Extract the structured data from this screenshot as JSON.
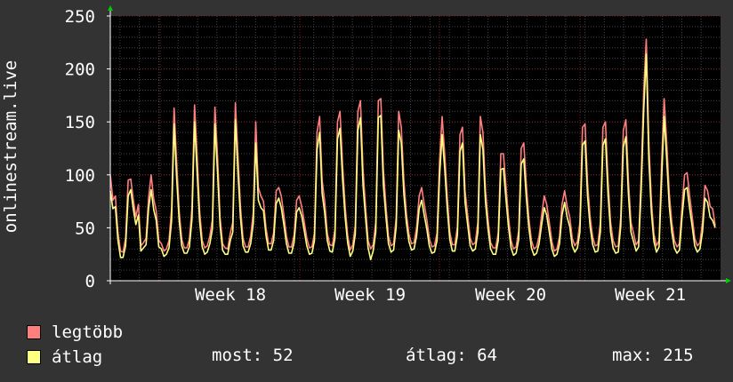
{
  "chart_data": {
    "type": "line",
    "ylabel": "onlinestream.live",
    "ylim": [
      0,
      250
    ],
    "yticks": [
      0,
      50,
      100,
      150,
      200,
      250
    ],
    "xticks": [
      "Week 18",
      "Week 19",
      "Week 20",
      "Week 21"
    ],
    "grid": true,
    "legend_position": "bottom-left",
    "series": [
      {
        "name": "legtöbb",
        "color": "#ff7f7f",
        "values": [
          100,
          76,
          80,
          45,
          28,
          27,
          40,
          95,
          96,
          77,
          60,
          72,
          33,
          36,
          40,
          78,
          100,
          77,
          66,
          38,
          35,
          28,
          30,
          38,
          68,
          163,
          111,
          65,
          39,
          31,
          31,
          39,
          69,
          166,
          118,
          66,
          38,
          31,
          33,
          42,
          58,
          164,
          118,
          60,
          35,
          31,
          30,
          45,
          55,
          168,
          118,
          70,
          40,
          32,
          32,
          42,
          64,
          150,
          88,
          80,
          75,
          50,
          35,
          35,
          45,
          85,
          88,
          80,
          62,
          42,
          32,
          32,
          43,
          76,
          80,
          70,
          55,
          40,
          31,
          32,
          45,
          140,
          155,
          95,
          75,
          45,
          34,
          33,
          48,
          150,
          160,
          110,
          70,
          43,
          29,
          34,
          52,
          160,
          170,
          105,
          70,
          38,
          30,
          34,
          55,
          170,
          172,
          105,
          70,
          42,
          33,
          35,
          60,
          160,
          145,
          95,
          64,
          44,
          35,
          36,
          50,
          80,
          88,
          72,
          58,
          40,
          32,
          33,
          45,
          113,
          155,
          120,
          80,
          46,
          34,
          34,
          51,
          138,
          145,
          85,
          62,
          40,
          34,
          36,
          55,
          155,
          140,
          85,
          58,
          36,
          31,
          31,
          45,
          120,
          120,
          90,
          60,
          38,
          30,
          32,
          47,
          125,
          130,
          90,
          59,
          38,
          30,
          32,
          42,
          62,
          80,
          72,
          55,
          37,
          28,
          30,
          42,
          72,
          85,
          70,
          60,
          40,
          33,
          37,
          55,
          145,
          148,
          92,
          60,
          41,
          33,
          34,
          55,
          145,
          150,
          95,
          55,
          38,
          32,
          33,
          60,
          142,
          152,
          95,
          55,
          45,
          34,
          38,
          100,
          180,
          228,
          130,
          75,
          44,
          33,
          38,
          110,
          172,
          130,
          82,
          55,
          38,
          32,
          35,
          70,
          100,
          102,
          80,
          60,
          40,
          33,
          36,
          55,
          90,
          85,
          70,
          68,
          52
        ]
      },
      {
        "name": "átlag",
        "color": "#ffff80",
        "values": [
          85,
          68,
          70,
          38,
          22,
          22,
          33,
          80,
          86,
          68,
          53,
          62,
          28,
          31,
          34,
          68,
          86,
          67,
          57,
          32,
          30,
          23,
          25,
          31,
          57,
          148,
          96,
          56,
          33,
          26,
          26,
          32,
          58,
          150,
          102,
          56,
          32,
          25,
          27,
          35,
          49,
          148,
          103,
          52,
          29,
          25,
          25,
          38,
          46,
          152,
          102,
          60,
          33,
          27,
          27,
          35,
          54,
          130,
          76,
          69,
          66,
          43,
          29,
          29,
          38,
          73,
          78,
          69,
          53,
          35,
          26,
          26,
          36,
          65,
          69,
          61,
          47,
          33,
          25,
          26,
          38,
          124,
          140,
          83,
          64,
          38,
          28,
          27,
          40,
          134,
          144,
          96,
          60,
          36,
          23,
          28,
          44,
          142,
          154,
          90,
          60,
          31,
          20,
          28,
          46,
          154,
          156,
          90,
          60,
          35,
          27,
          29,
          51,
          142,
          130,
          82,
          55,
          37,
          29,
          30,
          42,
          68,
          76,
          62,
          49,
          33,
          26,
          27,
          38,
          98,
          138,
          106,
          69,
          39,
          28,
          28,
          43,
          122,
          130,
          74,
          53,
          33,
          28,
          30,
          46,
          138,
          124,
          74,
          49,
          30,
          25,
          25,
          38,
          105,
          106,
          78,
          51,
          31,
          24,
          26,
          39,
          110,
          115,
          78,
          50,
          31,
          24,
          26,
          35,
          53,
          69,
          62,
          46,
          30,
          23,
          25,
          35,
          62,
          74,
          60,
          51,
          33,
          27,
          31,
          46,
          128,
          132,
          80,
          51,
          34,
          27,
          28,
          46,
          128,
          134,
          82,
          46,
          31,
          26,
          27,
          51,
          126,
          136,
          82,
          46,
          37,
          28,
          32,
          86,
          162,
          214,
          114,
          64,
          37,
          27,
          32,
          94,
          155,
          114,
          70,
          46,
          31,
          26,
          29,
          60,
          86,
          88,
          68,
          51,
          33,
          27,
          30,
          46,
          78,
          74,
          60,
          57,
          50
        ]
      }
    ],
    "stats": {
      "most": 52,
      "atlag": 64,
      "max": 215
    }
  },
  "labels": {
    "most": "most: 52",
    "atlag": "átlag: 64",
    "max": "max: 215"
  }
}
